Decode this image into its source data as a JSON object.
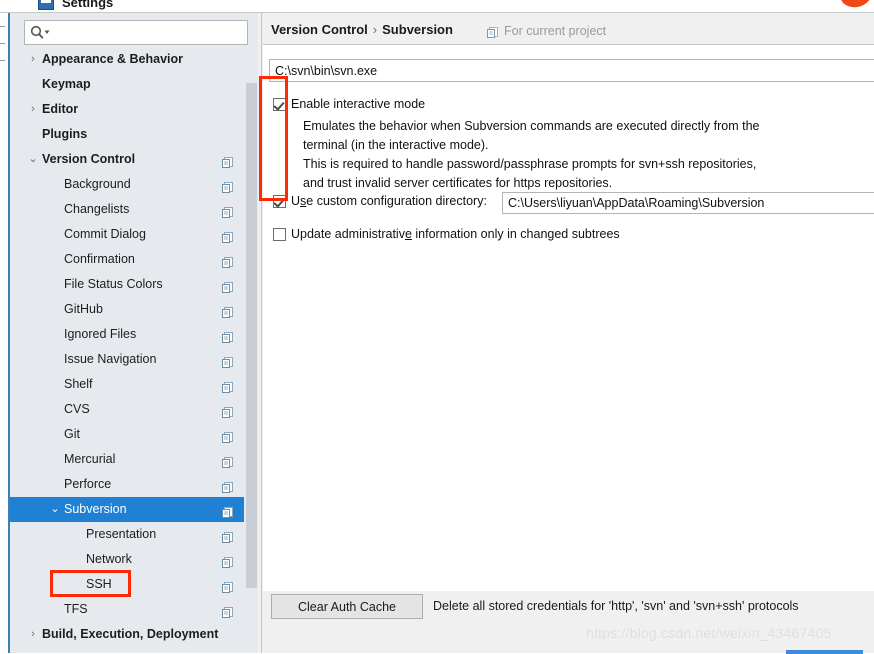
{
  "window": {
    "title": "Settings",
    "icon": "settings-window-icon",
    "brand_icon": "orange-brand-logo"
  },
  "sidebar": {
    "search": {
      "value": "",
      "placeholder": "",
      "icon": "search-icon"
    },
    "items": [
      {
        "label": "Appearance & Behavior",
        "level": 0,
        "arrow": "›",
        "config_icon": false,
        "selected": false
      },
      {
        "label": "Keymap",
        "level": 0,
        "arrow": "",
        "config_icon": false,
        "selected": false
      },
      {
        "label": "Editor",
        "level": 0,
        "arrow": "›",
        "config_icon": false,
        "selected": false
      },
      {
        "label": "Plugins",
        "level": 0,
        "arrow": "",
        "config_icon": false,
        "selected": false
      },
      {
        "label": "Version Control",
        "level": 0,
        "arrow": "⌄",
        "config_icon": true,
        "selected": false
      },
      {
        "label": "Background",
        "level": 1,
        "arrow": "",
        "config_icon": true,
        "selected": false
      },
      {
        "label": "Changelists",
        "level": 1,
        "arrow": "",
        "config_icon": true,
        "selected": false
      },
      {
        "label": "Commit Dialog",
        "level": 1,
        "arrow": "",
        "config_icon": true,
        "selected": false
      },
      {
        "label": "Confirmation",
        "level": 1,
        "arrow": "",
        "config_icon": true,
        "selected": false
      },
      {
        "label": "File Status Colors",
        "level": 1,
        "arrow": "",
        "config_icon": true,
        "selected": false
      },
      {
        "label": "GitHub",
        "level": 1,
        "arrow": "",
        "config_icon": true,
        "selected": false
      },
      {
        "label": "Ignored Files",
        "level": 1,
        "arrow": "",
        "config_icon": true,
        "selected": false
      },
      {
        "label": "Issue Navigation",
        "level": 1,
        "arrow": "",
        "config_icon": true,
        "selected": false
      },
      {
        "label": "Shelf",
        "level": 1,
        "arrow": "",
        "config_icon": true,
        "selected": false
      },
      {
        "label": "CVS",
        "level": 1,
        "arrow": "",
        "config_icon": true,
        "selected": false
      },
      {
        "label": "Git",
        "level": 1,
        "arrow": "",
        "config_icon": true,
        "selected": false
      },
      {
        "label": "Mercurial",
        "level": 1,
        "arrow": "",
        "config_icon": true,
        "selected": false
      },
      {
        "label": "Perforce",
        "level": 1,
        "arrow": "",
        "config_icon": true,
        "selected": false
      },
      {
        "label": "Subversion",
        "level": 1,
        "arrow": "⌄",
        "config_icon": true,
        "selected": true
      },
      {
        "label": "Presentation",
        "level": 2,
        "arrow": "",
        "config_icon": true,
        "selected": false
      },
      {
        "label": "Network",
        "level": 2,
        "arrow": "",
        "config_icon": true,
        "selected": false
      },
      {
        "label": "SSH",
        "level": 2,
        "arrow": "",
        "config_icon": true,
        "selected": false
      },
      {
        "label": "TFS",
        "level": 1,
        "arrow": "",
        "config_icon": true,
        "selected": false
      },
      {
        "label": "Build, Execution, Deployment",
        "level": 0,
        "arrow": "›",
        "config_icon": false,
        "selected": false
      }
    ]
  },
  "content": {
    "breadcrumb": {
      "root": "Version Control",
      "separator": "›",
      "current": "Subversion"
    },
    "scope": {
      "icon": "project-scope-icon",
      "label": "For current project"
    },
    "svn_path": {
      "value": "C:\\svn\\bin\\svn.exe",
      "placeholder": ""
    },
    "interactive": {
      "checked": true,
      "label": "Enable interactive mode",
      "description": [
        "Emulates the behavior when Subversion commands are executed directly from the",
        "terminal (in the interactive mode).",
        "This is required to handle password/passphrase prompts for svn+ssh repositories,",
        "and trust invalid server certificates for https repositories."
      ]
    },
    "custom_config": {
      "checked": true,
      "label_before": "U",
      "label_mnemonic": "s",
      "label_after": "e custom configuration directory:",
      "value": "C:\\Users\\liyuan\\AppData\\Roaming\\Subversion",
      "placeholder": ""
    },
    "update_admin": {
      "checked": false,
      "label_before": "Update administrativ",
      "label_mnemonic": "e",
      "label_after": " information only in changed subtrees"
    },
    "clear_auth": {
      "button_label": "Clear Auth Cache",
      "note": "Delete all stored credentials for 'http', 'svn' and 'svn+ssh' protocols"
    }
  },
  "annotations": {
    "checkbox_highlight": "red-box-around-checkboxes",
    "ssh_highlight": "red-box-around-ssh-item"
  },
  "watermark": "https://blog.csdn.net/weixin_43467405",
  "colors": {
    "selection_blue": "#1f80d4",
    "annotation_red": "#fc2b06",
    "sidebar_bg": "#e6eaee",
    "panel_bg": "#f0f0f0",
    "brand_orange": "#ef4815"
  }
}
